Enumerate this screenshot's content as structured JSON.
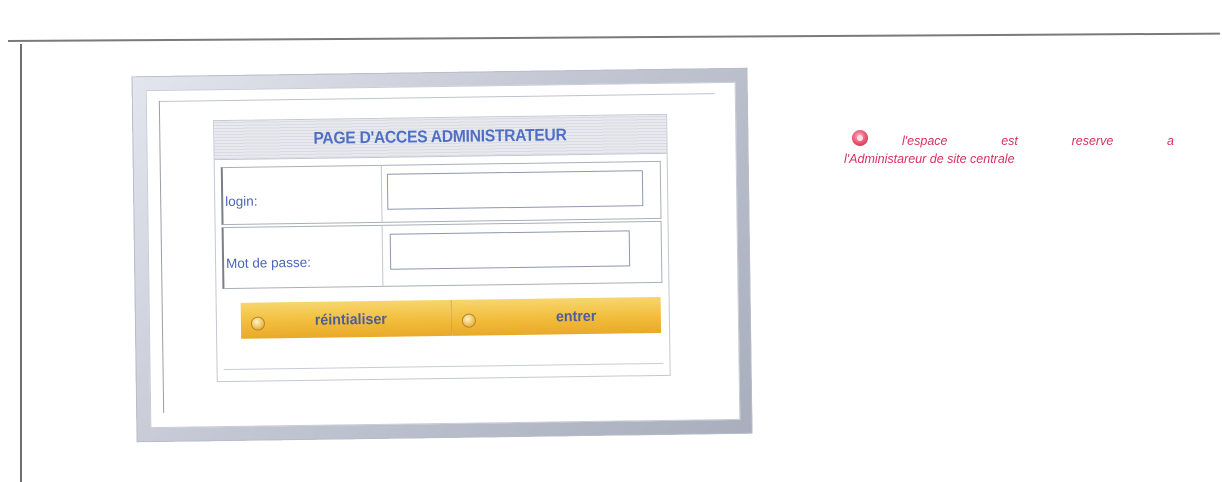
{
  "login_panel": {
    "title": "PAGE D'ACCES ADMINISTRATEUR",
    "login_label": "login:",
    "login_value": "",
    "password_label": "Mot de passe:",
    "password_value": "",
    "reset_button_label": "réintialiser",
    "enter_button_label": "entrer"
  },
  "notice": {
    "icon": "red-bullet-icon",
    "line1_words": [
      "l'espace",
      "est",
      "reserve",
      "a"
    ],
    "line2": "l'Administareur de site centrale"
  },
  "colors": {
    "title_blue": "#4f6fc7",
    "label_blue": "#4a66b8",
    "button_gold": "#f2bd3b",
    "notice_red": "#d8315f"
  }
}
